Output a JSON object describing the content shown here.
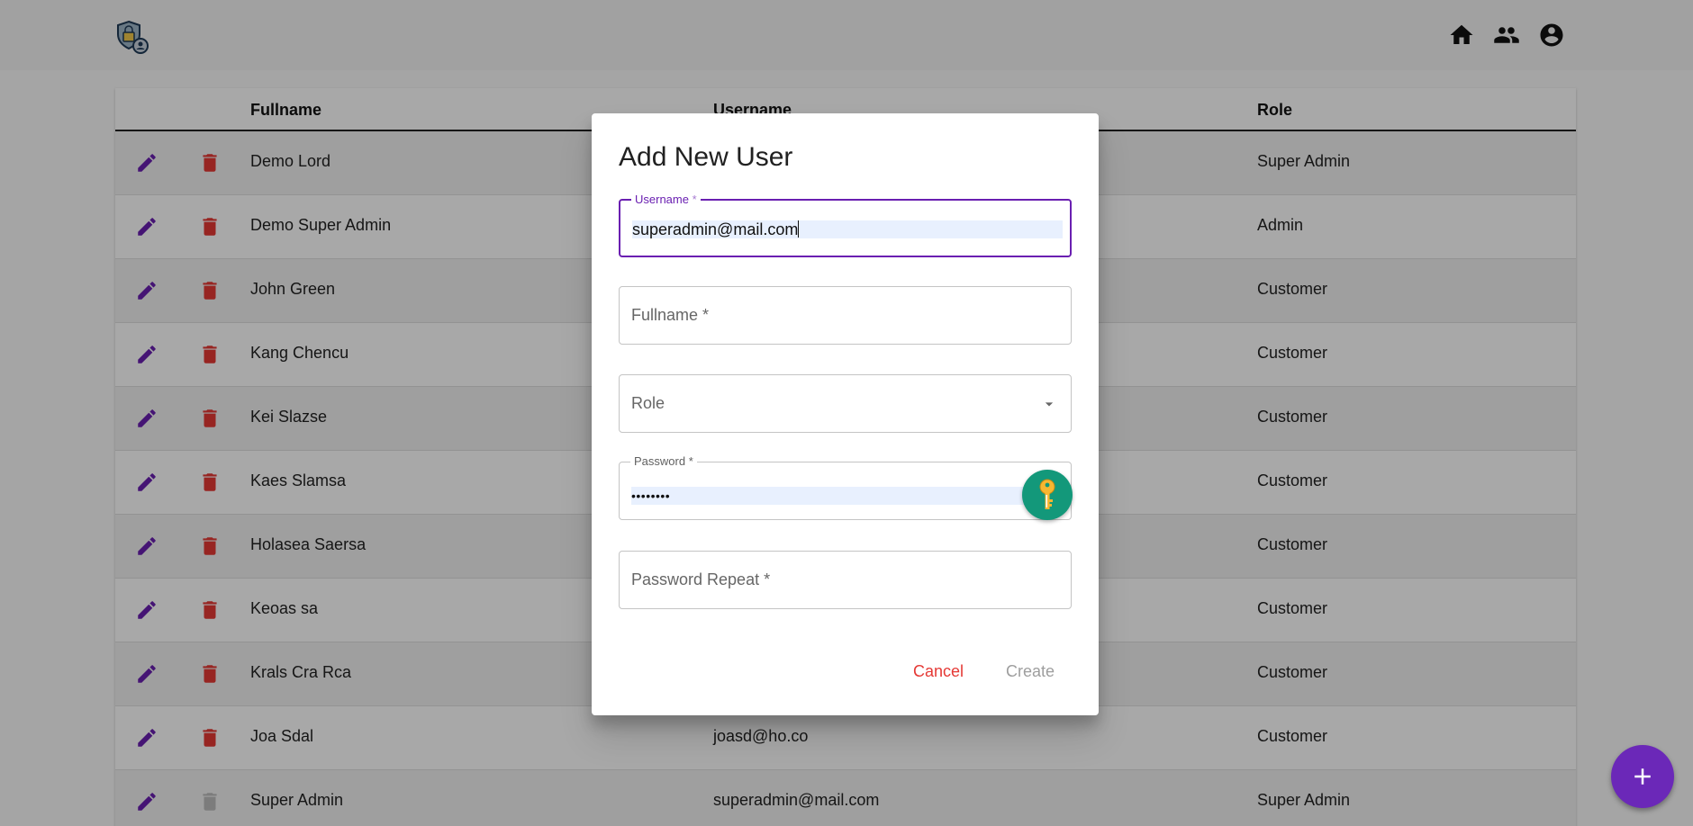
{
  "header": {
    "logo_icon": "shield-lock-user-icon",
    "icons": [
      "home-icon",
      "people-icon",
      "account-circle-icon"
    ]
  },
  "table": {
    "columns": {
      "fullname": "Fullname",
      "username": "Username",
      "role": "Role"
    },
    "rows": [
      {
        "fullname": "Demo Lord",
        "username": "",
        "role": "Super Admin"
      },
      {
        "fullname": "Demo Super Admin",
        "username": "",
        "role": "Admin"
      },
      {
        "fullname": "John Green",
        "username": "",
        "role": "Customer"
      },
      {
        "fullname": "Kang Chencu",
        "username": "",
        "role": "Customer"
      },
      {
        "fullname": "Kei Slazse",
        "username": "",
        "role": "Customer"
      },
      {
        "fullname": "Kaes Slamsa",
        "username": "",
        "role": "Customer"
      },
      {
        "fullname": "Holasea Saersa",
        "username": "",
        "role": "Customer"
      },
      {
        "fullname": "Keoas sa",
        "username": "",
        "role": "Customer"
      },
      {
        "fullname": "Krals Cra Rca",
        "username": "",
        "role": "Customer"
      },
      {
        "fullname": "Joa Sdal",
        "username": "joasd@ho.co",
        "role": "Customer"
      },
      {
        "fullname": "Super Admin",
        "username": "superadmin@mail.com",
        "role": "Super Admin"
      }
    ]
  },
  "dialog": {
    "title": "Add New User",
    "username": {
      "label": "Username",
      "required": "*",
      "value": "superadmin@mail.com"
    },
    "fullname": {
      "placeholder": "Fullname *"
    },
    "role": {
      "placeholder": "Role"
    },
    "password": {
      "label": "Password *",
      "value": "••••••••"
    },
    "password_repeat": {
      "placeholder": "Password Repeat *"
    },
    "cancel_label": "Cancel",
    "create_label": "Create"
  },
  "colors": {
    "accent": "#6a1fb1",
    "danger": "#e53935",
    "fab": "#6b28b8",
    "password_manager": "#13987a"
  }
}
